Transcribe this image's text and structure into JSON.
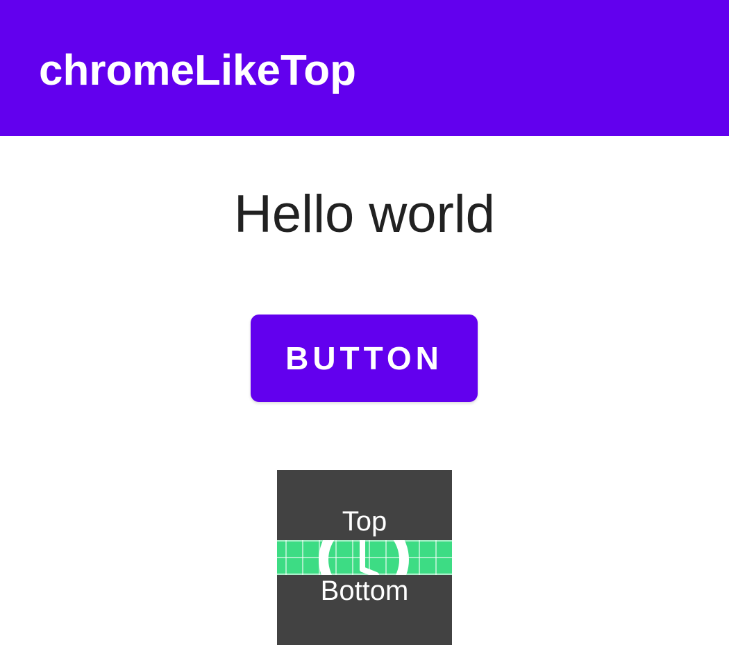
{
  "app_bar": {
    "title": "chromeLikeTop",
    "color": "#6200EE"
  },
  "main": {
    "greeting": "Hello world",
    "button_label": "BUTTON"
  },
  "widget": {
    "top_label": "Top",
    "bottom_label": "Bottom",
    "icon": "clock-icon",
    "band_color": "#3DDC84",
    "background_color": "#424242"
  }
}
